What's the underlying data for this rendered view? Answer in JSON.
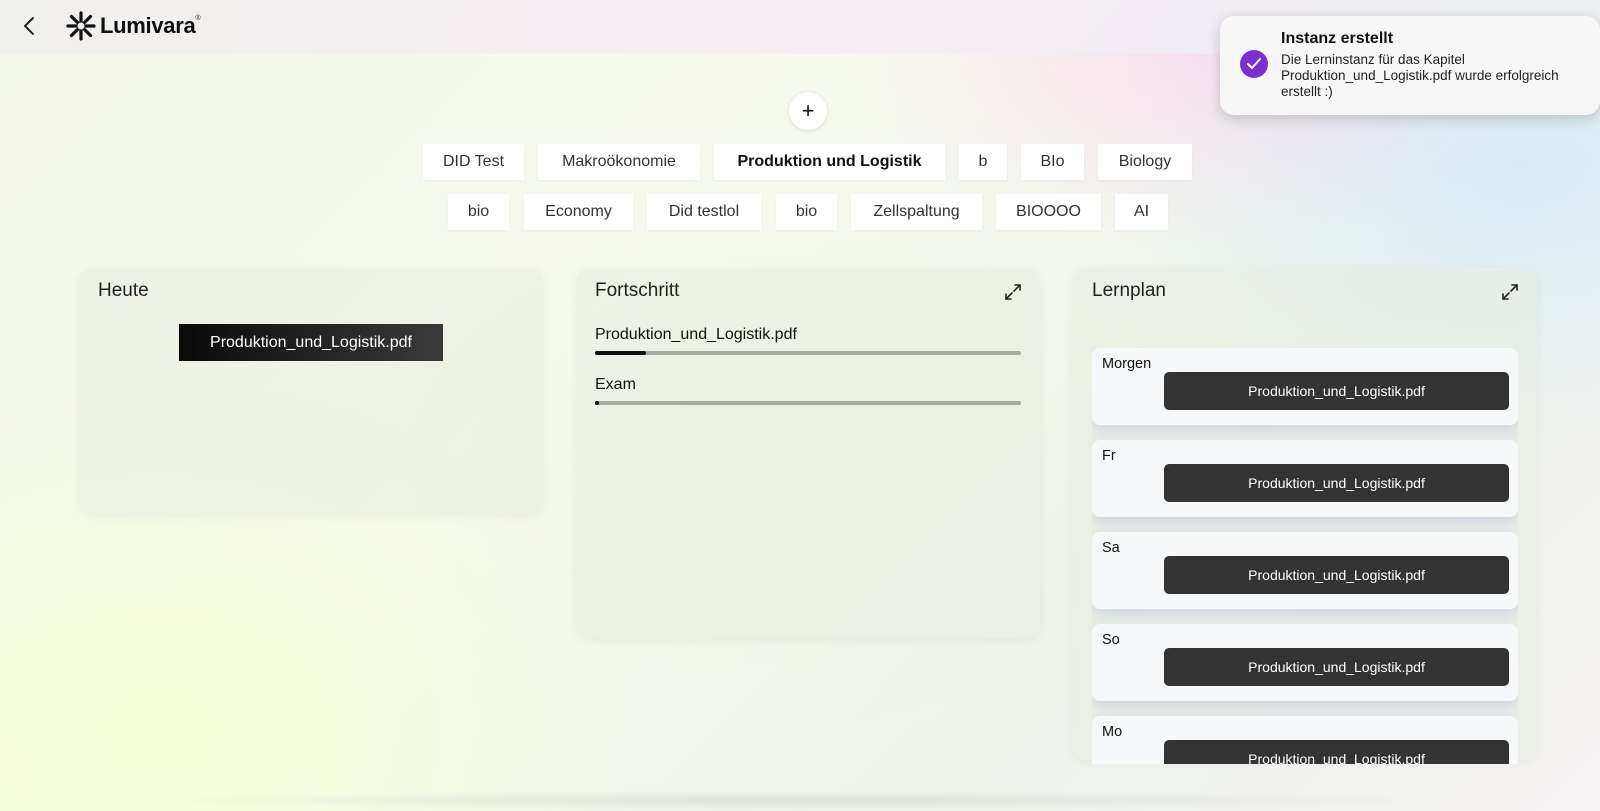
{
  "header": {
    "back_icon": "chevron-left-icon",
    "logo_icon": "starburst-icon",
    "logo_text": "Lumivara",
    "logo_mark": "®"
  },
  "toast": {
    "icon": "check-circle-icon",
    "icon_color": "#7a2fd0",
    "title": "Instanz erstellt",
    "body": "Die Lerninstanz für das Kapitel Produktion_und_Logistik.pdf wurde erfolgreich erstellt :)"
  },
  "add_button": {
    "icon": "plus-icon",
    "label": "+"
  },
  "subjects": {
    "row1": [
      "DID Test",
      "Makroökonomie",
      "Produktion und Logistik",
      "b",
      "BIo",
      "Biology"
    ],
    "row2": [
      "bio",
      "Economy",
      "Did testlol",
      "bio",
      "Zellspaltung",
      "BIOOOO",
      "AI"
    ],
    "active": "Produktion und Logistik"
  },
  "today": {
    "title": "Heute",
    "document": "Produktion_und_Logistik.pdf"
  },
  "progress": {
    "title": "Fortschritt",
    "expand_icon": "expand-icon",
    "items": [
      {
        "label": "Produktion_und_Logistik.pdf",
        "value": 0.12
      },
      {
        "label": "Exam",
        "value": 0.01
      }
    ]
  },
  "plan": {
    "title": "Lernplan",
    "expand_icon": "expand-icon",
    "days": [
      {
        "label": "Morgen",
        "document": "Produktion_und_Logistik.pdf"
      },
      {
        "label": "Fr",
        "document": "Produktion_und_Logistik.pdf"
      },
      {
        "label": "Sa",
        "document": "Produktion_und_Logistik.pdf"
      },
      {
        "label": "So",
        "document": "Produktion_und_Logistik.pdf"
      },
      {
        "label": "Mo",
        "document": "Produktion_und_Logistik.pdf"
      }
    ]
  }
}
